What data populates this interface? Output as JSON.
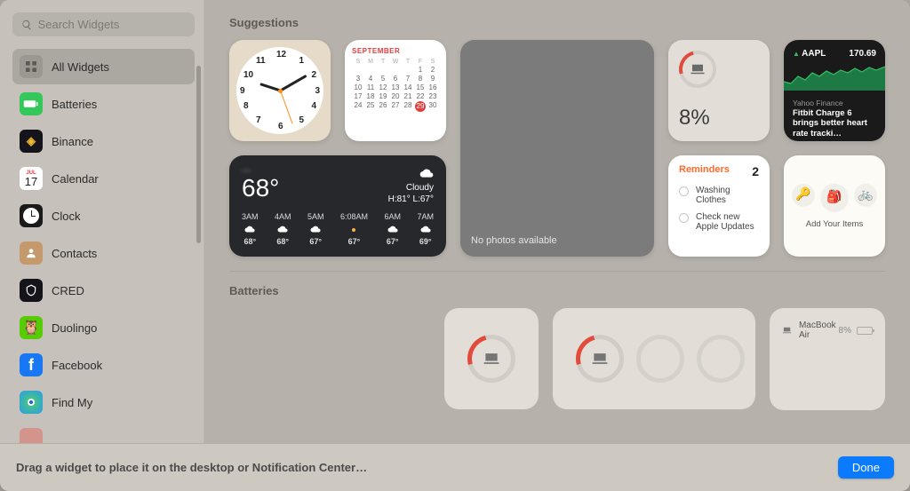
{
  "search": {
    "placeholder": "Search Widgets"
  },
  "sidebar": {
    "items": [
      {
        "label": "All Widgets"
      },
      {
        "label": "Batteries"
      },
      {
        "label": "Binance"
      },
      {
        "label": "Calendar"
      },
      {
        "label": "Clock"
      },
      {
        "label": "Contacts"
      },
      {
        "label": "CRED"
      },
      {
        "label": "Duolingo"
      },
      {
        "label": "Facebook"
      },
      {
        "label": "Find My"
      }
    ],
    "calendar_icon": {
      "month": "JUL",
      "day": "17"
    }
  },
  "sections": {
    "suggestions": "Suggestions",
    "batteries": "Batteries"
  },
  "calendar": {
    "month": "SEPTEMBER",
    "dow": [
      "S",
      "M",
      "T",
      "W",
      "T",
      "F",
      "S"
    ],
    "leading_blanks": 5,
    "days": 30,
    "today": 29
  },
  "weather": {
    "location": "—",
    "temp": "68°",
    "condition": "Cloudy",
    "hi_lo": "H:81° L:67°",
    "hours": [
      {
        "t": "3AM",
        "v": "68°",
        "icon": "cloud"
      },
      {
        "t": "4AM",
        "v": "68°",
        "icon": "cloud"
      },
      {
        "t": "5AM",
        "v": "67°",
        "icon": "cloud"
      },
      {
        "t": "6:08AM",
        "v": "67°",
        "icon": "sunrise"
      },
      {
        "t": "6AM",
        "v": "67°",
        "icon": "cloud"
      },
      {
        "t": "7AM",
        "v": "69°",
        "icon": "cloud"
      }
    ]
  },
  "photos": {
    "empty": "No photos available"
  },
  "battery": {
    "pct": "8%"
  },
  "stocks": {
    "symbol": "AAPL",
    "price": "170.69",
    "source": "Yahoo Finance",
    "headline": "Fitbit Charge 6 brings better heart rate tracki…"
  },
  "reminders": {
    "title": "Reminders",
    "count": "2",
    "items": [
      "Washing Clothes",
      "Check new Apple Updates"
    ]
  },
  "findmy": {
    "label": "Add Your Items"
  },
  "batt_list": {
    "device": "MacBook Air",
    "pct": "8%"
  },
  "footer": {
    "hint": "Drag a widget to place it on the desktop or Notification Center…",
    "done": "Done"
  }
}
